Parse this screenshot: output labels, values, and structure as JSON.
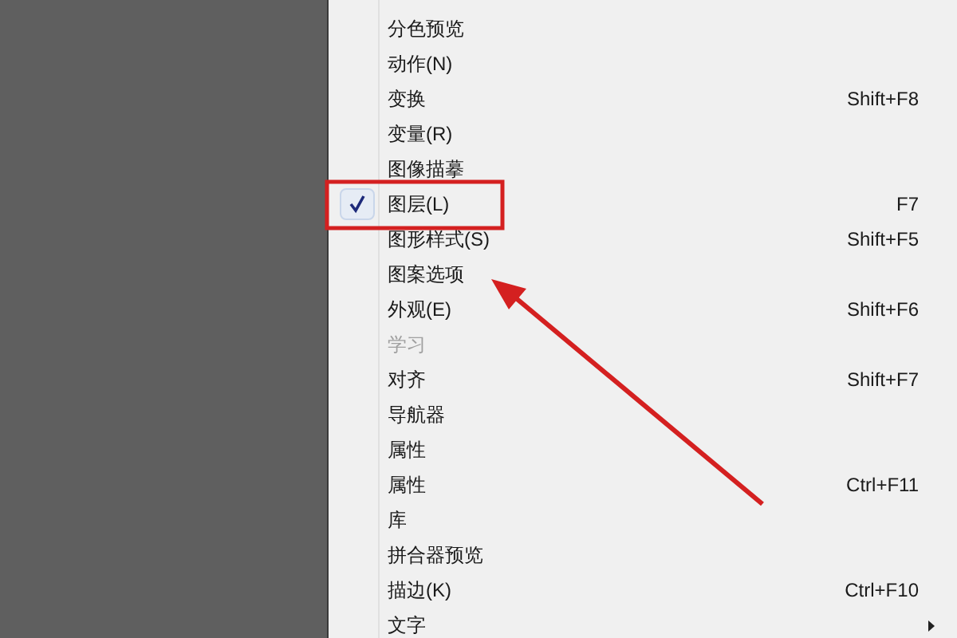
{
  "menu": {
    "items": [
      {
        "label": "分色预览",
        "checked": false,
        "disabled": false,
        "submenu": false
      },
      {
        "label": "动作(N)",
        "checked": false,
        "disabled": false,
        "submenu": false
      },
      {
        "label": "变换",
        "shortcut": "Shift+F8",
        "checked": false,
        "disabled": false,
        "submenu": false
      },
      {
        "label": "变量(R)",
        "checked": false,
        "disabled": false,
        "submenu": false
      },
      {
        "label": "图像描摹",
        "checked": false,
        "disabled": false,
        "submenu": false
      },
      {
        "label": "图层(L)",
        "shortcut": "F7",
        "checked": true,
        "disabled": false,
        "submenu": false
      },
      {
        "label": "图形样式(S)",
        "shortcut": "Shift+F5",
        "checked": false,
        "disabled": false,
        "submenu": false
      },
      {
        "label": "图案选项",
        "checked": false,
        "disabled": false,
        "submenu": false
      },
      {
        "label": "外观(E)",
        "shortcut": "Shift+F6",
        "checked": false,
        "disabled": false,
        "submenu": false
      },
      {
        "label": "学习",
        "checked": false,
        "disabled": true,
        "submenu": false
      },
      {
        "label": "对齐",
        "shortcut": "Shift+F7",
        "checked": false,
        "disabled": false,
        "submenu": false
      },
      {
        "label": "导航器",
        "checked": false,
        "disabled": false,
        "submenu": false
      },
      {
        "label": "属性",
        "checked": false,
        "disabled": false,
        "submenu": false
      },
      {
        "label": "属性",
        "shortcut": "Ctrl+F11",
        "checked": false,
        "disabled": false,
        "submenu": false
      },
      {
        "label": "库",
        "checked": false,
        "disabled": false,
        "submenu": false
      },
      {
        "label": "拼合器预览",
        "checked": false,
        "disabled": false,
        "submenu": false
      },
      {
        "label": "描边(K)",
        "shortcut": "Ctrl+F10",
        "checked": false,
        "disabled": false,
        "submenu": false
      },
      {
        "label": "文字",
        "checked": false,
        "disabled": false,
        "submenu": true
      }
    ]
  }
}
